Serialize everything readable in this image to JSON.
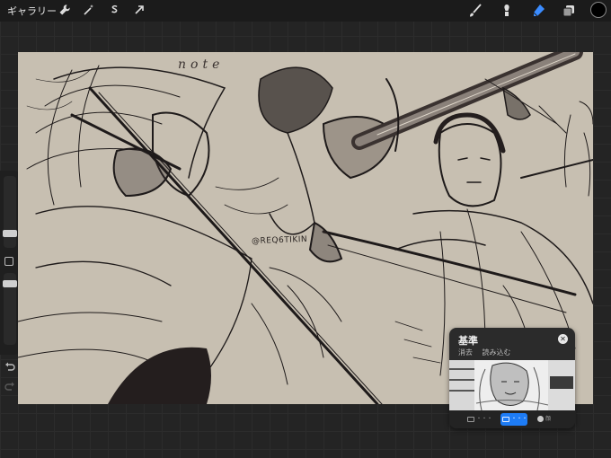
{
  "topbar": {
    "gallery_label": "ギャラリー",
    "left_tools": [
      "wrench-icon",
      "magic-wand-icon",
      "selection-s-icon",
      "transform-arrow-icon"
    ],
    "right_tools": [
      "brush-icon",
      "smudge-icon",
      "eraser-icon",
      "layers-icon"
    ],
    "active_tool": "eraser-icon",
    "active_tool_color": "#3b8cff",
    "current_color": "#000000"
  },
  "sidebar": {
    "controls": [
      "brush-size-slider",
      "modify-button",
      "opacity-slider",
      "undo-icon",
      "redo-icon"
    ]
  },
  "canvas": {
    "signature": "note",
    "watermark": "@REQ6TIKIN",
    "paper_color": "#c7bfb1",
    "ink_color": "#1e1a1a"
  },
  "reference_panel": {
    "title": "基準",
    "actions": [
      "消去",
      "読み込む"
    ],
    "tabs": [
      {
        "label": "・・・",
        "icon": "canvas-icon"
      },
      {
        "label": "・・・",
        "icon": "image-icon",
        "active": true
      },
      {
        "label": "顔",
        "icon": "face-icon"
      }
    ],
    "accent_color": "#1e7cf5"
  }
}
